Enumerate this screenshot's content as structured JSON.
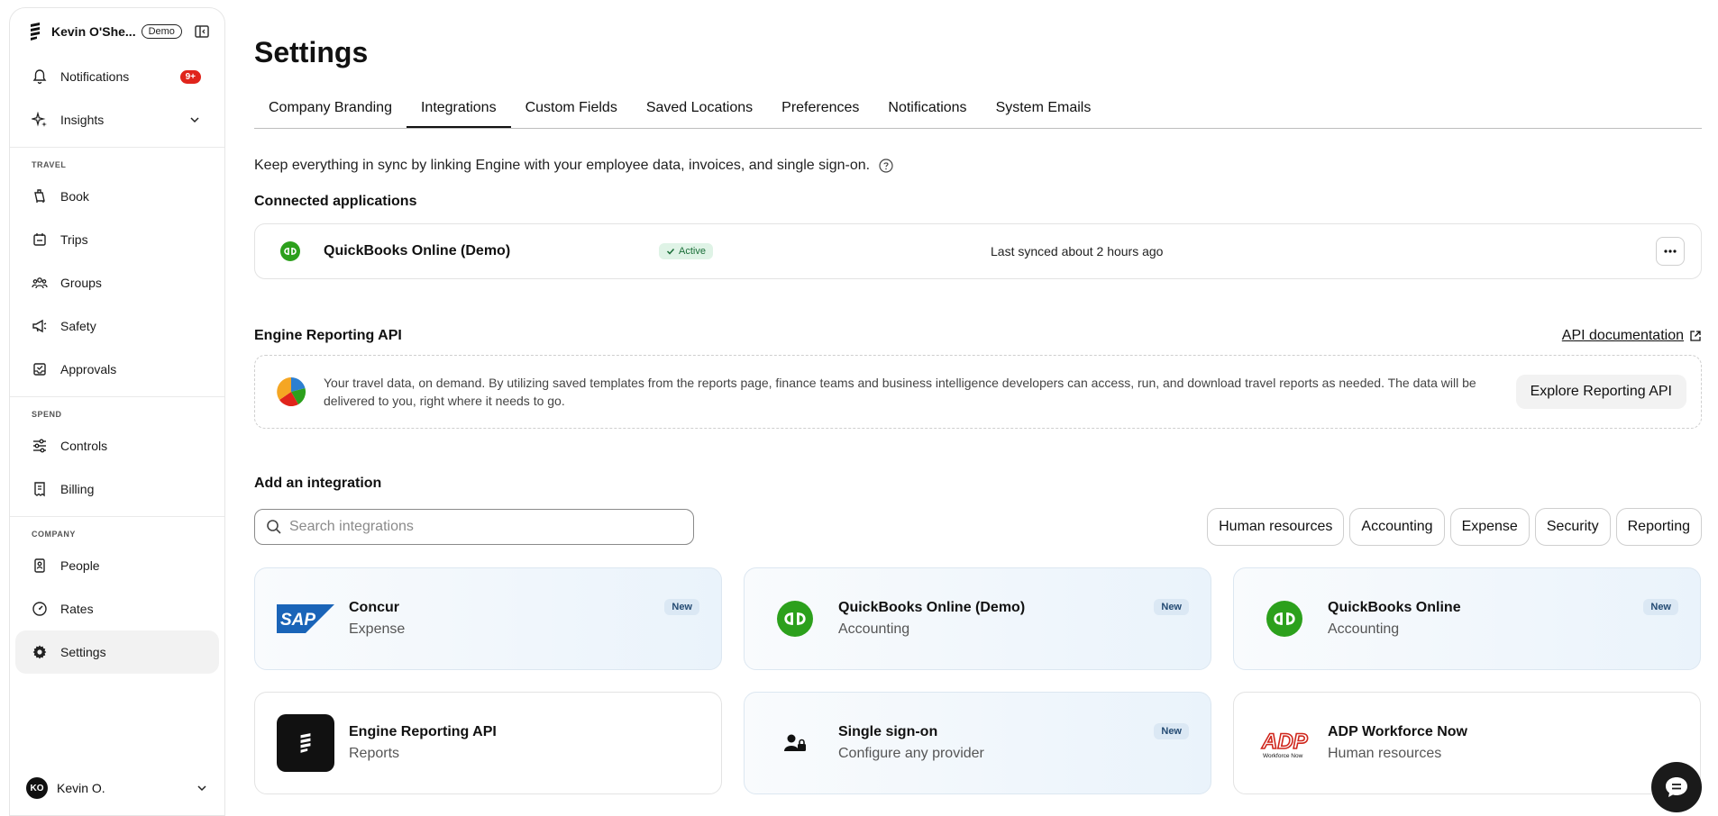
{
  "sidebar": {
    "account_name": "Kevin O'She...",
    "demo_label": "Demo",
    "notifications_label": "Notifications",
    "notifications_badge": "9+",
    "insights_label": "Insights",
    "sections": {
      "travel": "TRAVEL",
      "spend": "SPEND",
      "company": "COMPANY"
    },
    "items": {
      "book": "Book",
      "trips": "Trips",
      "groups": "Groups",
      "safety": "Safety",
      "approvals": "Approvals",
      "controls": "Controls",
      "billing": "Billing",
      "people": "People",
      "rates": "Rates",
      "settings": "Settings"
    },
    "user_initials": "KO",
    "user_name": "Kevin O."
  },
  "main": {
    "title": "Settings",
    "tabs": [
      "Company Branding",
      "Integrations",
      "Custom Fields",
      "Saved Locations",
      "Preferences",
      "Notifications",
      "System Emails"
    ],
    "active_tab": "Integrations",
    "intro": "Keep everything in sync by linking Engine with your employee data, invoices, and single sign-on.",
    "connected_title": "Connected applications",
    "connected": {
      "name": "QuickBooks Online (Demo)",
      "status": "Active",
      "synced": "Last synced about 2 hours ago"
    },
    "api_section_title": "Engine Reporting API",
    "api_doc_link": "API documentation",
    "api_desc": "Your travel data, on demand. By utilizing saved templates from the reports page, finance teams and business intelligence developers can access, run, and download travel reports as needed. The data will be delivered to you, right where it needs to go.",
    "api_button": "Explore Reporting API",
    "add_title": "Add an integration",
    "search_placeholder": "Search integrations",
    "filters": [
      "Human resources",
      "Accounting",
      "Expense",
      "Security",
      "Reporting"
    ],
    "integrations": [
      {
        "name": "Concur",
        "category": "Expense",
        "badge": "New",
        "logo": "sap-logo"
      },
      {
        "name": "QuickBooks Online (Demo)",
        "category": "Accounting",
        "badge": "New",
        "logo": "quickbooks-logo"
      },
      {
        "name": "QuickBooks Online",
        "category": "Accounting",
        "badge": "New",
        "logo": "quickbooks-logo"
      },
      {
        "name": "Engine Reporting API",
        "category": "Reports",
        "badge": "",
        "logo": "engine-logo"
      },
      {
        "name": "Single sign-on",
        "category": "Configure any provider",
        "badge": "New",
        "logo": "user-lock-icon"
      },
      {
        "name": "ADP Workforce Now",
        "category": "Human resources",
        "badge": "",
        "logo": "adp-logo"
      }
    ],
    "sap_logo_text": "SAP",
    "adp_logo_text": "ADP",
    "adp_logo_sub": "Workforce Now"
  },
  "colors": {
    "accent_dark": "#111111",
    "badge_red": "#e0241b",
    "quickbooks_green": "#2ca01c",
    "active_green_bg": "#dff3e6",
    "new_badge_bg": "#dbe8f4",
    "sap_blue": "#1a64b8",
    "adp_red": "#d0271d"
  }
}
